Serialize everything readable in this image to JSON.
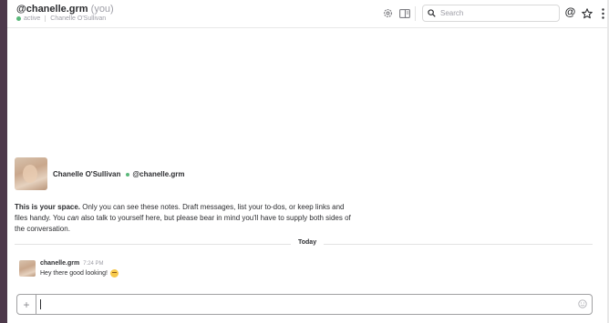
{
  "header": {
    "channel_name": "@chanelle.grm",
    "you_suffix": "(you)",
    "status": "active",
    "full_name": "Chanelle O'Sullivan",
    "search_placeholder": "Search",
    "at_symbol": "@"
  },
  "intro": {
    "name": "Chanelle O'Sullivan",
    "handle": "@chanelle.grm",
    "text_bold": "This is your space.",
    "text_part1": " Only you can see these notes. Draft messages, list your to-dos, or keep links and files handy. You ",
    "text_italic": "can",
    "text_part2": " also talk to yourself here, but please bear in mind you'll have to supply both sides of the conversation."
  },
  "day_divider": "Today",
  "messages": [
    {
      "author": "chanelle.grm",
      "time": "7:24 PM",
      "text": "Hey there good looking!"
    }
  ],
  "composer": {
    "plus": "+"
  },
  "colors": {
    "sidebar": "#4d394b",
    "presence": "#5ab87a",
    "notification": "#e01e5a"
  },
  "icons": [
    "gear-icon",
    "panel-icon",
    "search-icon",
    "at-icon",
    "star-icon",
    "more-icon",
    "plus-icon",
    "emoji-icon"
  ]
}
